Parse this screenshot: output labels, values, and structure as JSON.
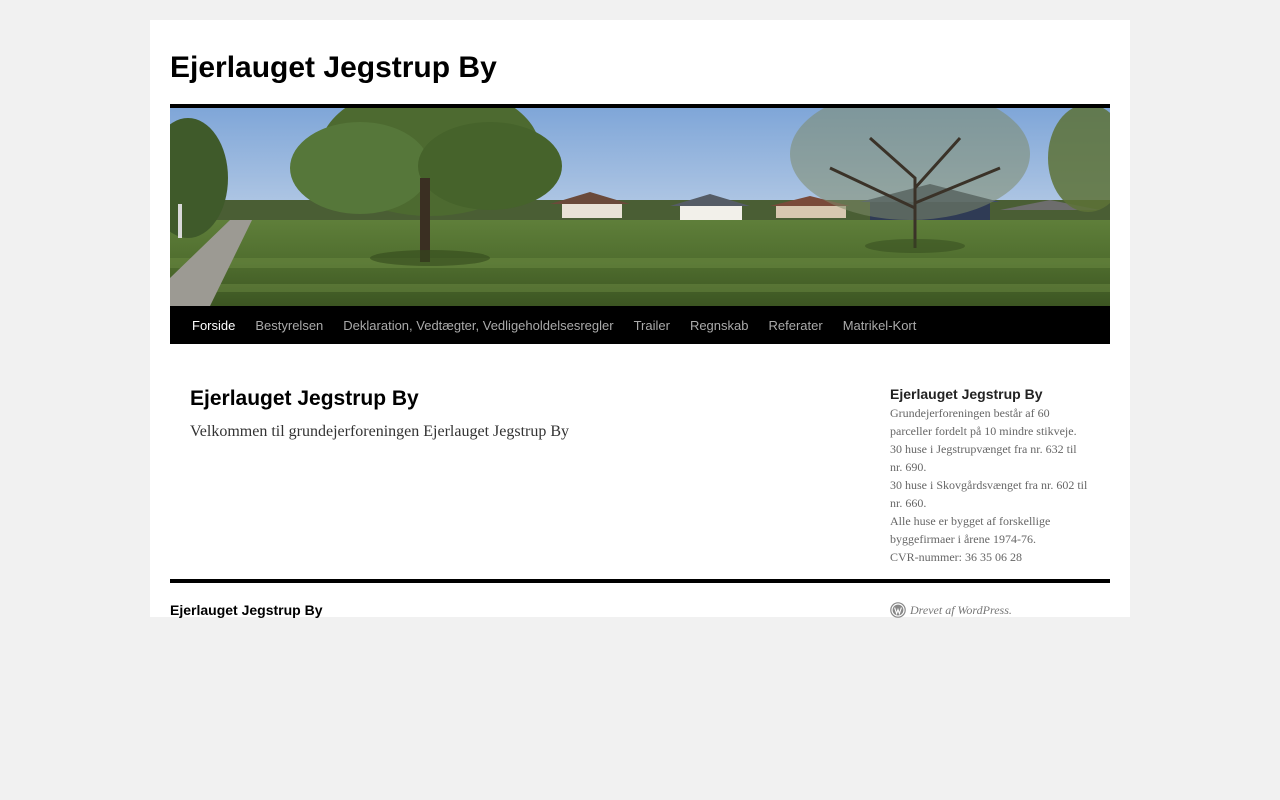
{
  "site": {
    "title": "Ejerlauget Jegstrup By"
  },
  "nav": {
    "items": [
      {
        "label": "Forside",
        "current": true
      },
      {
        "label": "Bestyrelsen"
      },
      {
        "label": "Deklaration, Vedtægter, Vedligeholdelsesregler"
      },
      {
        "label": "Trailer"
      },
      {
        "label": "Regnskab"
      },
      {
        "label": "Referater"
      },
      {
        "label": "Matrikel-Kort"
      }
    ]
  },
  "main": {
    "title": "Ejerlauget Jegstrup By",
    "text": "Velkommen til grundejerforeningen Ejerlauget Jegstrup By"
  },
  "sidebar": {
    "title": "Ejerlauget Jegstrup By",
    "lines": [
      "Grundejerforeningen består af 60 parceller fordelt på 10 mindre stikveje.",
      "30 huse i Jegstrupvænget fra nr. 632 til nr. 690.",
      "30 huse i Skovgårdsvænget fra nr. 602 til nr. 660.",
      "Alle huse er bygget af forskellige byggefirmaer i årene 1974-76.",
      "CVR-nummer: 36 35 06 28"
    ]
  },
  "footer": {
    "title": "Ejerlauget Jegstrup By",
    "credit": "Drevet af WordPress.",
    "credit_icon": "wordpress-icon"
  },
  "colors": {
    "page_background": "#f1f1f1",
    "nav_background": "#000000",
    "nav_text": "#aaaaaa",
    "nav_current": "#ffffff",
    "sidebar_text": "#666666"
  }
}
